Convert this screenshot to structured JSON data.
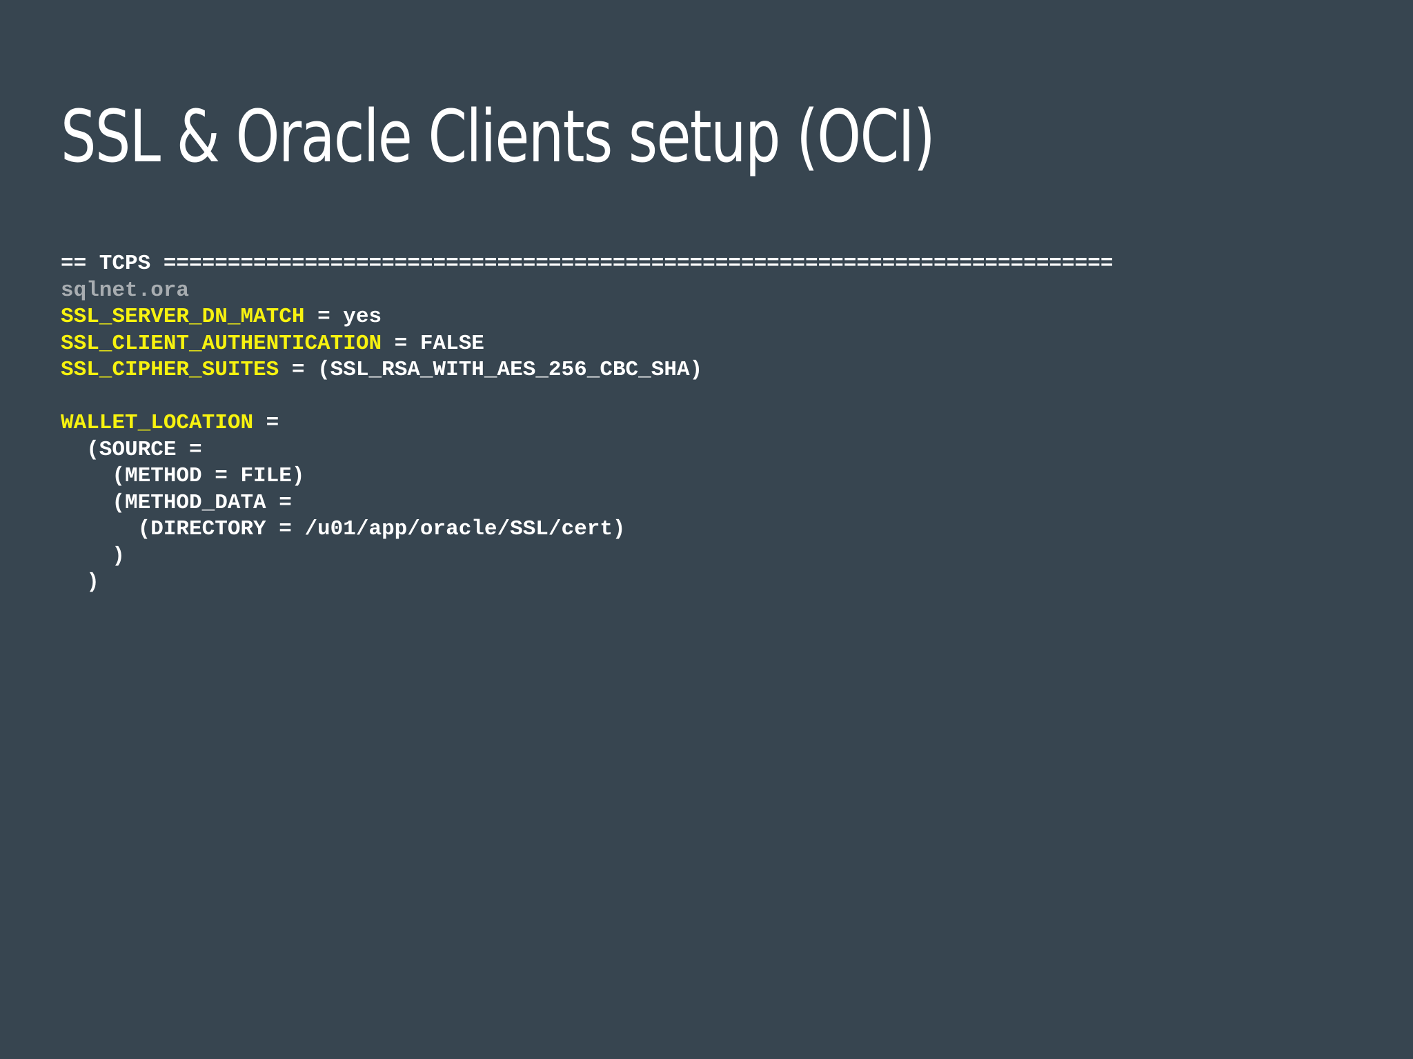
{
  "slide": {
    "title": "SSL & Oracle Clients setup (OCI)",
    "background_color": "#374550"
  },
  "colors": {
    "plain": "#ffffff",
    "keyword": "#f7f20f",
    "comment": "#a8adb1"
  },
  "code": {
    "lines": [
      {
        "segments": [
          {
            "text": "== TCPS ==========================================================================",
            "color": "white"
          }
        ]
      },
      {
        "segments": [
          {
            "text": "sqlnet.ora",
            "color": "gray"
          }
        ]
      },
      {
        "segments": [
          {
            "text": "SSL_SERVER_DN_MATCH",
            "color": "yellow"
          },
          {
            "text": " = yes",
            "color": "white"
          }
        ]
      },
      {
        "segments": [
          {
            "text": "SSL_CLIENT_AUTHENTICATION",
            "color": "yellow"
          },
          {
            "text": " = FALSE",
            "color": "white"
          }
        ]
      },
      {
        "segments": [
          {
            "text": "SSL_CIPHER_SUITES",
            "color": "yellow"
          },
          {
            "text": " = (SSL_RSA_WITH_AES_256_CBC_SHA)",
            "color": "white"
          }
        ]
      },
      {
        "segments": [
          {
            "text": "",
            "color": "white"
          }
        ]
      },
      {
        "segments": [
          {
            "text": "WALLET_LOCATION",
            "color": "yellow"
          },
          {
            "text": " =",
            "color": "white"
          }
        ]
      },
      {
        "segments": [
          {
            "text": "  (SOURCE =",
            "color": "white"
          }
        ]
      },
      {
        "segments": [
          {
            "text": "    (METHOD = FILE)",
            "color": "white"
          }
        ]
      },
      {
        "segments": [
          {
            "text": "    (METHOD_DATA =",
            "color": "white"
          }
        ]
      },
      {
        "segments": [
          {
            "text": "      (DIRECTORY = /u01/app/oracle/SSL/cert)",
            "color": "white"
          }
        ]
      },
      {
        "segments": [
          {
            "text": "    )",
            "color": "white"
          }
        ]
      },
      {
        "segments": [
          {
            "text": "  )",
            "color": "white"
          }
        ]
      }
    ]
  }
}
